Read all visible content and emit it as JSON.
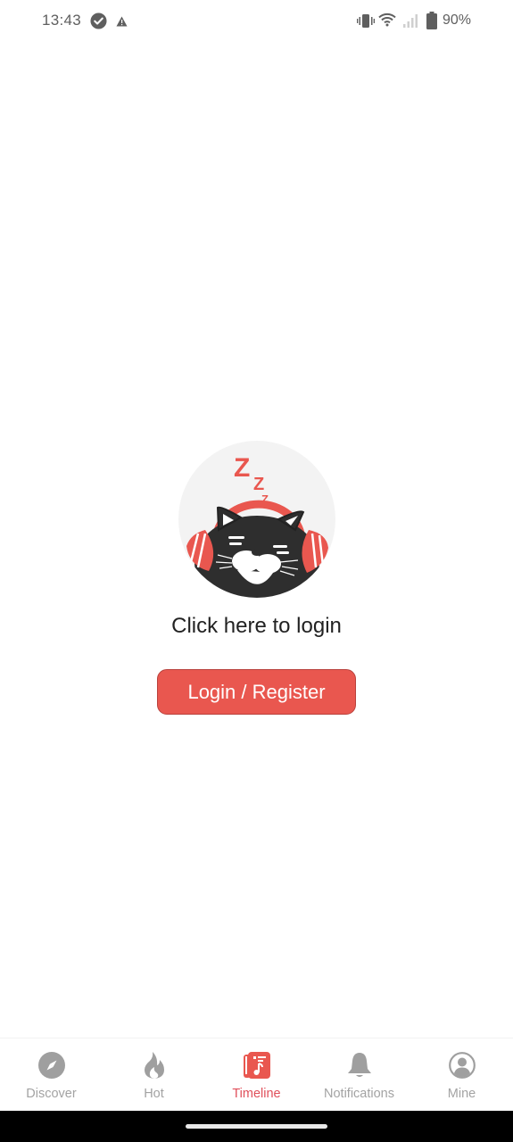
{
  "status_bar": {
    "time": "13:43",
    "left_icons": [
      "check-circle-icon",
      "warning-icon"
    ],
    "right_icons": [
      "vibrate-icon",
      "wifi-icon",
      "signal-icon",
      "battery-icon"
    ],
    "battery_percent": "90%"
  },
  "empty_state": {
    "illustration": "sleeping-cat-headphones",
    "prompt": "Click here to login",
    "button_label": "Login / Register"
  },
  "tab_bar": {
    "active_index": 2,
    "tabs": [
      {
        "label": "Discover",
        "icon": "compass-icon"
      },
      {
        "label": "Hot",
        "icon": "flame-icon"
      },
      {
        "label": "Timeline",
        "icon": "timeline-music-icon"
      },
      {
        "label": "Notifications",
        "icon": "bell-icon"
      },
      {
        "label": "Mine",
        "icon": "user-circle-icon"
      }
    ]
  },
  "colors": {
    "accent": "#e9574f",
    "active_tab": "#e0505b",
    "inactive_tab": "#a3a3a3"
  }
}
